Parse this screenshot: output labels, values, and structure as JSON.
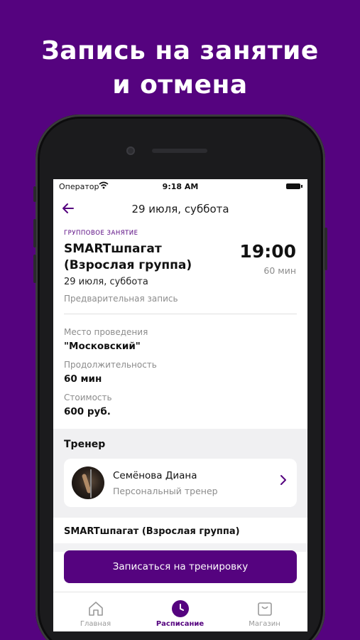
{
  "promo": {
    "title_line1": "Запись на занятие",
    "title_line2": "и отмена"
  },
  "status_bar": {
    "carrier": "Оператор",
    "time": "9:18 AM"
  },
  "nav": {
    "title": "29 июля, суббота"
  },
  "class": {
    "type_label": "ГРУППОВОЕ ЗАНЯТИЕ",
    "name": "SMARTшпагат (Взрослая группа)",
    "time": "19:00",
    "duration_short": "60 мин",
    "date": "29 июля, суббота",
    "booking_type": "Предварительная запись"
  },
  "details": {
    "location_label": "Место проведения",
    "location_value": "\"Московский\"",
    "duration_label": "Продолжительность",
    "duration_value": "60 мин",
    "price_label": "Стоимость",
    "price_value": "600 руб."
  },
  "trainer": {
    "section_title": "Тренер",
    "name": "Семёнова Диана",
    "role": "Персональный тренер"
  },
  "footer": {
    "class_name": "SMARTшпагат (Взрослая группа)",
    "book_button": "Записаться на тренировку"
  },
  "tabs": [
    {
      "label": "Главная",
      "icon": "home-icon"
    },
    {
      "label": "Расписание",
      "icon": "clock-icon"
    },
    {
      "label": "Магазин",
      "icon": "shopping-bag-icon"
    }
  ],
  "colors": {
    "brand_purple": "#55037f",
    "background_purple": "#55037f"
  }
}
